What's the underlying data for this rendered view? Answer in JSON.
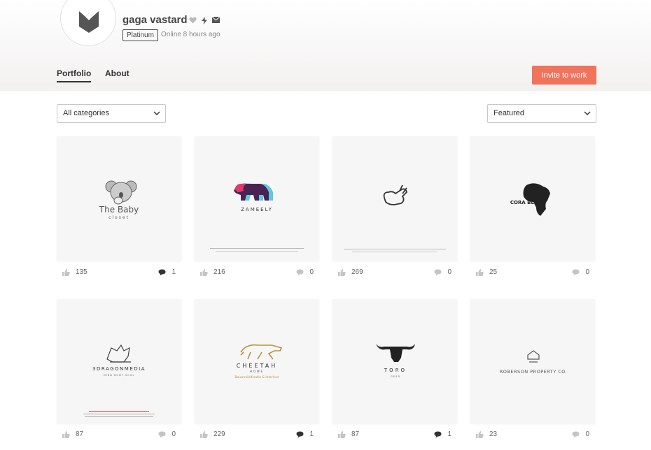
{
  "profile": {
    "name": "gaga vastard",
    "badge": "Platinum",
    "status": "Online 8 hours ago"
  },
  "tabs": [
    {
      "label": "Portfolio",
      "active": true
    },
    {
      "label": "About",
      "active": false
    }
  ],
  "invite_label": "Invite to work",
  "filters": {
    "category": "All categories",
    "sort": "Featured"
  },
  "colors": {
    "accent": "#f0735c",
    "header_bg": "#f2f1f0"
  },
  "portfolio": [
    {
      "title": "The Baby",
      "subtitle": "closet",
      "likes": "135",
      "comments": "1"
    },
    {
      "title": "ZAMEELY",
      "subtitle": "",
      "likes": "216",
      "comments": "0"
    },
    {
      "title": "",
      "subtitle": "",
      "likes": "269",
      "comments": "0"
    },
    {
      "title": "CORA BLUE",
      "subtitle": "",
      "likes": "25",
      "comments": "0"
    },
    {
      "title": "3DRAGONMEDIA",
      "subtitle": "MIND BODY SOUL",
      "likes": "87",
      "comments": "0"
    },
    {
      "title": "CHEETAH",
      "subtitle": "HOME",
      "tagline": "Bouwcoördinatie & Interieur",
      "likes": "229",
      "comments": "1"
    },
    {
      "title": "TORO",
      "subtitle": "GEAR",
      "likes": "87",
      "comments": "1"
    },
    {
      "title": "ROBERSON PROPERTY CO.",
      "subtitle": "",
      "likes": "23",
      "comments": "0"
    }
  ]
}
